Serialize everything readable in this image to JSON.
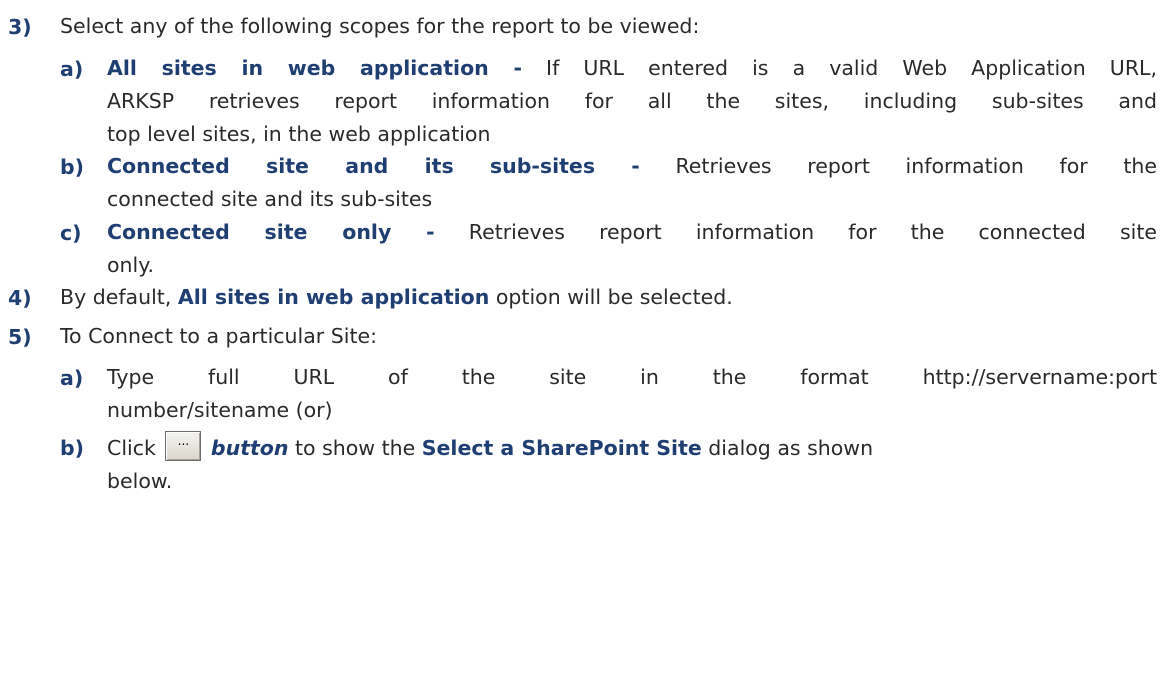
{
  "item3": {
    "number": "3)",
    "text": "Select any of the following scopes for the report to be viewed:",
    "sub": [
      {
        "letter": "a)",
        "heading": "All sites in web application -",
        "line1": " If URL entered is a valid Web Application URL,",
        "line2": "ARKSP retrieves report information for all the sites, including sub-sites and",
        "line3": "top level sites, in the web application"
      },
      {
        "letter": "b)",
        "heading": "Connected site and its sub-sites -",
        "line1": " Retrieves report information for the",
        "line2": "connected site and its sub-sites"
      },
      {
        "letter": "c)",
        "heading": "Connected site only -",
        "line1": " Retrieves report information for the connected site",
        "line2": "only."
      }
    ]
  },
  "item4": {
    "number": "4)",
    "prefix": "By default, ",
    "bold": "All sites in web application",
    "suffix": " option will be selected."
  },
  "item5": {
    "number": "5)",
    "text": "To Connect to a particular Site:",
    "sub_a": {
      "letter": "a)",
      "line1": "Type full URL of the site in the format http://servername:port",
      "line2": "number/sitename (or)"
    },
    "sub_b": {
      "letter": "b)",
      "click": "Click",
      "button_glyph": "...",
      "button_word": "button",
      "middle": " to show the ",
      "dialog_name": "Select a SharePoint Site",
      "end1": " dialog as shown",
      "line2": "below."
    }
  }
}
